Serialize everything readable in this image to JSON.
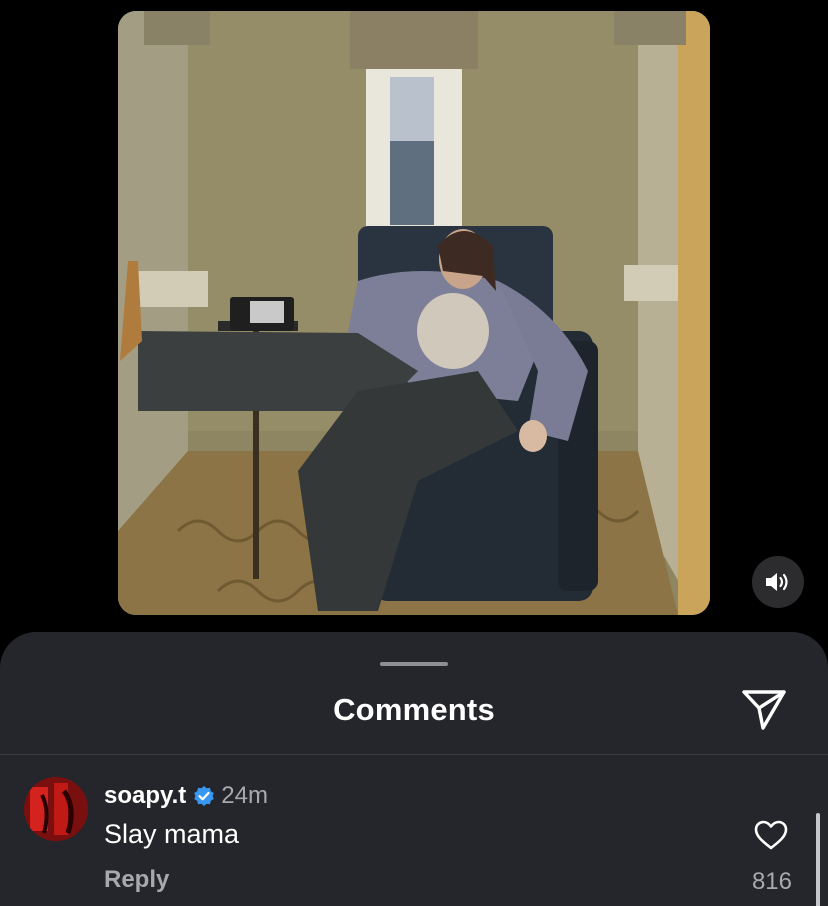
{
  "post": {
    "photo_icon": "post-photo",
    "audio_icon": "speaker-icon"
  },
  "comments_sheet": {
    "title": "Comments",
    "share_icon": "send-icon"
  },
  "comments": [
    {
      "username": "soapy.t",
      "verified": true,
      "timestamp": "24m",
      "text": "Slay mama",
      "reply_label": "Reply",
      "like_count": "816",
      "like_icon": "heart-outline-icon",
      "avatar_icon": "user-avatar"
    }
  ],
  "colors": {
    "background": "#000000",
    "sheet_background": "#25262b",
    "verified_badge": "#3897f0",
    "secondary_text": "#a8a8ad"
  }
}
